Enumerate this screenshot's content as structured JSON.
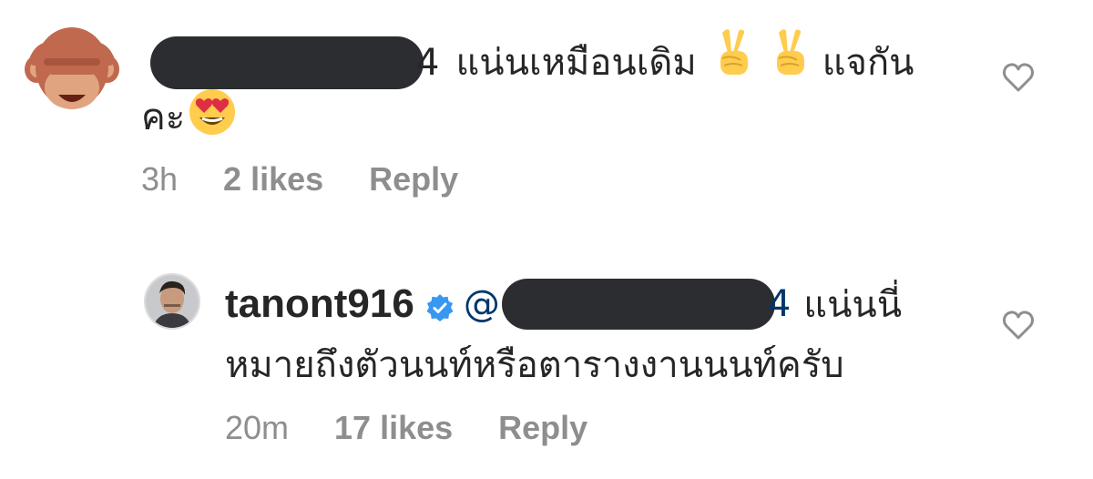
{
  "comments": [
    {
      "avatar": "see-no-evil-monkey-emoji",
      "mention_tail": "4",
      "text_part1": "แน่นเหมือนเดิม",
      "emoji_1": "victory-hand-emoji",
      "emoji_2": "victory-hand-emoji",
      "text_part2": "แจกัน",
      "text_line2": "คะ",
      "emoji_3": "heart-eyes-emoji",
      "time": "3h",
      "likes": "2 likes",
      "reply": "Reply"
    },
    {
      "avatar": "user-avatar-photo",
      "username": "tanont916",
      "verified_icon": "verified-badge-icon",
      "mention_at": "@",
      "mention_tail": "4",
      "text_part1": "แน่นนี่",
      "text_line2": "หมายถึงตัวนนท์หรือตารางงานนนท์ครับ",
      "time": "20m",
      "likes": "17 likes",
      "reply": "Reply"
    }
  ],
  "colors": {
    "text": "#262626",
    "meta": "#8e8e8e",
    "mention": "#00376b",
    "verified": "#3897f0",
    "redaction": "#2b2d30"
  }
}
